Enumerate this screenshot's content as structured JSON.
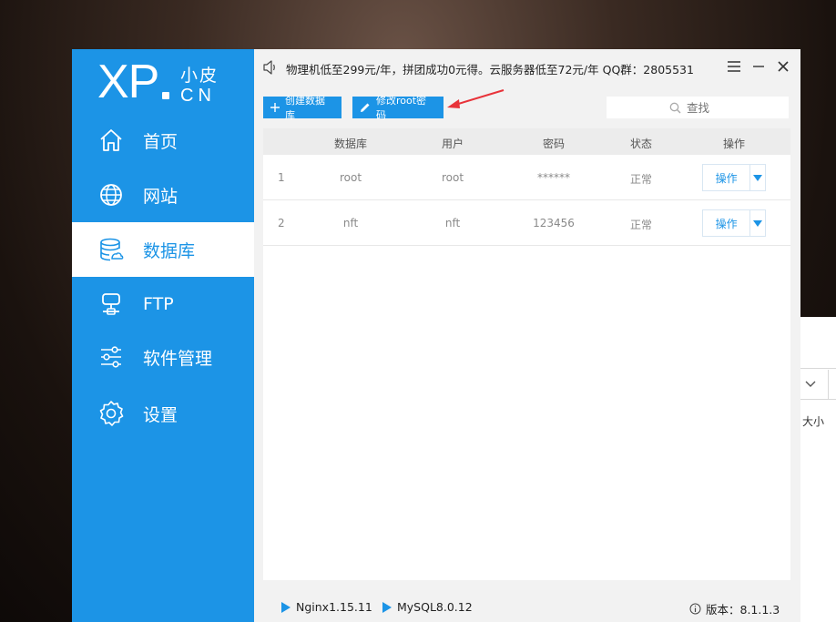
{
  "background_window": {
    "label": "大小"
  },
  "logo": {
    "xp": "XP",
    "small": "小皮",
    "cn": "CN"
  },
  "sidebar": {
    "items": [
      {
        "label": "首页",
        "icon": "home-icon",
        "active": false
      },
      {
        "label": "网站",
        "icon": "globe-icon",
        "active": false
      },
      {
        "label": "数据库",
        "icon": "database-icon",
        "active": true
      },
      {
        "label": "FTP",
        "icon": "ftp-server-icon",
        "active": false
      },
      {
        "label": "软件管理",
        "icon": "sliders-icon",
        "active": false
      },
      {
        "label": "设置",
        "icon": "gear-icon",
        "active": false
      }
    ]
  },
  "topbar": {
    "notice": "物理机低至299元/年，拼团成功0元得。云服务器低至72元/年  QQ群：2805531"
  },
  "toolbar": {
    "create_label": "创建数据库",
    "modify_label": "修改root密码",
    "search_placeholder": "查找"
  },
  "table": {
    "headers": [
      "数据库",
      "用户",
      "密码",
      "状态",
      "操作"
    ],
    "rows": [
      {
        "index": "1",
        "database": "root",
        "user": "root",
        "password": "******",
        "status": "正常",
        "action": "操作"
      },
      {
        "index": "2",
        "database": "nft",
        "user": "nft",
        "password": "123456",
        "status": "正常",
        "action": "操作"
      }
    ]
  },
  "footer": {
    "nginx": "Nginx1.15.11",
    "mysql": "MySQL8.0.12",
    "version": "版本：8.1.1.3"
  },
  "colors": {
    "accent": "#1c94e6",
    "annotation_arrow": "#e8333a"
  }
}
